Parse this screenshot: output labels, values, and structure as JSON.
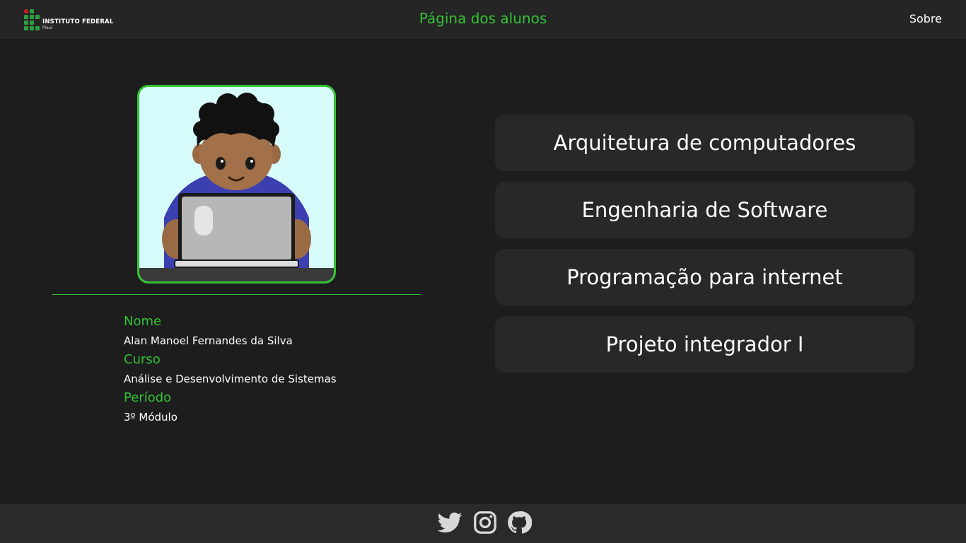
{
  "header": {
    "logo": {
      "title": "INSTITUTO FEDERAL",
      "subtitle": "Piauí"
    },
    "title": "Página dos alunos",
    "about_link": "Sobre"
  },
  "profile": {
    "fields": [
      {
        "label": "Nome",
        "value": "Alan Manoel Fernandes da Silva"
      },
      {
        "label": "Curso",
        "value": "Análise e Desenvolvimento de Sistemas"
      },
      {
        "label": "Período",
        "value": "3º Módulo"
      }
    ]
  },
  "subjects": [
    "Arquitetura de computadores",
    "Engenharia de Software",
    "Programação para internet",
    "Projeto integrador I"
  ],
  "footer": {
    "icons": [
      "twitter-icon",
      "instagram-icon",
      "github-icon"
    ]
  },
  "colors": {
    "accent": "#34c234",
    "background": "#1d1d1e",
    "header_bg": "#252526",
    "card_bg": "#282829"
  }
}
